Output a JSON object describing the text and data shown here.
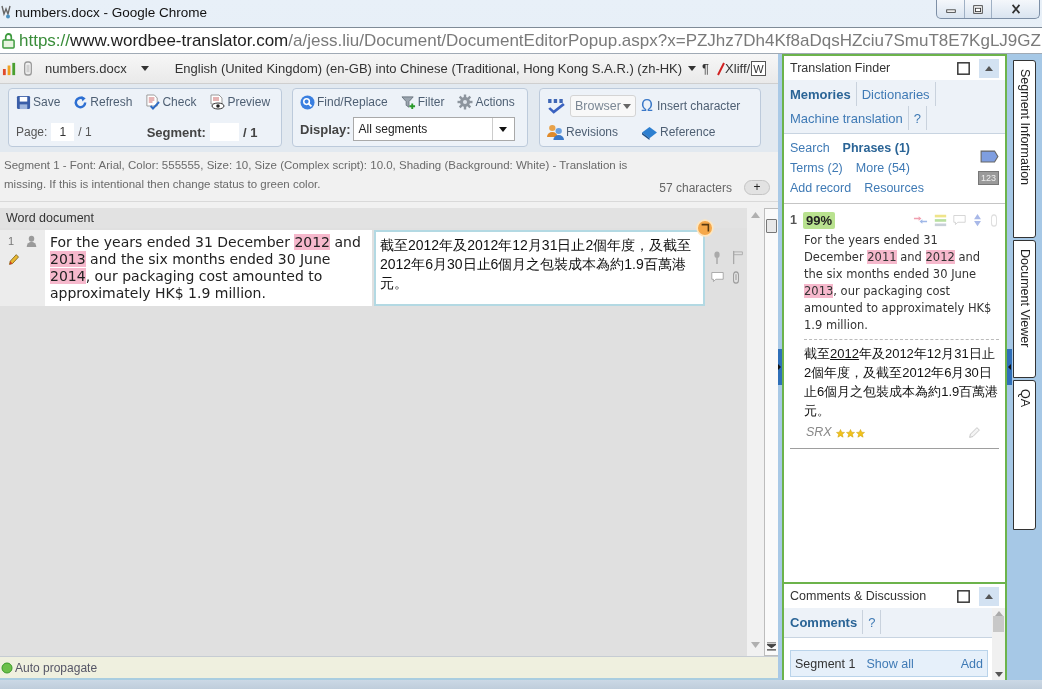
{
  "window": {
    "title": "numbers.docx - Google Chrome"
  },
  "address_bar": {
    "scheme": "https://",
    "host": "www.wordbee-translator.com",
    "path": "/a/jess.liu/Document/DocumentEditorPopup.aspx?x=PZJhz7Dh4Kf8aDqsHZciu7SmuT8E7KgLJ9GZ"
  },
  "document_bar": {
    "file": "numbers.docx",
    "languages": "English (United Kingdom) (en-GB) into Chinese (Traditional, Hong Kong S.A.R.) (zh-HK)",
    "pilcrow": "¶",
    "export": {
      "xliff": "Xliff/",
      "word": "W"
    }
  },
  "toolbar": {
    "edit_group": {
      "buttons": [
        {
          "kind": "save",
          "label": "Save"
        },
        {
          "kind": "refresh",
          "label": "Refresh"
        },
        {
          "kind": "check",
          "label": "Check"
        },
        {
          "kind": "preview",
          "label": "Preview"
        }
      ],
      "page": {
        "label": "Page:",
        "value": "1",
        "total": "/ 1"
      },
      "segment": {
        "label": "Segment:",
        "total": "/ 1"
      }
    },
    "search_group": {
      "buttons": [
        {
          "kind": "find",
          "label": "Find/Replace"
        },
        {
          "kind": "filter",
          "label": "Filter"
        },
        {
          "kind": "actions",
          "label": "Actions"
        }
      ],
      "display": {
        "label": "Display:",
        "value": "All segments"
      }
    },
    "tools_group": {
      "spellcheck": {
        "label": "Browser"
      },
      "buttons": [
        {
          "kind": "insert",
          "glyph": "Ω",
          "label": "Insert character"
        },
        {
          "kind": "revisions",
          "label": "Revisions"
        },
        {
          "kind": "reference",
          "label": "Reference"
        }
      ]
    }
  },
  "segment_info": {
    "message": "Segment 1 - Font: Arial, Color: 555555, Size: 10, Size (Complex script): 10.0, Shading (Background: White) - Translation is missing. If this is intentional then change status to green color.",
    "character_count": "57 characters",
    "expand_button": "+"
  },
  "document": {
    "header": "Word document",
    "segments": [
      {
        "number": "1",
        "source": [
          {
            "text": "For the years ended 31 December ",
            "kind": "plain"
          },
          {
            "text": "2012",
            "kind": "highlight"
          },
          {
            "text": " and ",
            "kind": "plain"
          },
          {
            "text": "2013",
            "kind": "highlight"
          },
          {
            "text": " and the six months ended 30 June ",
            "kind": "plain"
          },
          {
            "text": "2014",
            "kind": "highlight"
          },
          {
            "text": ", our packaging cost amounted to approximately HK$ 1.9 million.",
            "kind": "plain"
          }
        ],
        "target": [
          {
            "text": "截至2012年及2012年12月31日止2個年度，及截至2012年6月30日止6個月之包裝成本為約1.9百萬港元。",
            "kind": "plain"
          }
        ]
      }
    ]
  },
  "status_bar": {
    "auto_propagate": {
      "label": "Auto propagate",
      "on": true
    }
  },
  "translation_finder": {
    "title": "Translation Finder",
    "tabs": [
      {
        "label": "Memories",
        "selected": true
      },
      {
        "label": "Dictionaries",
        "selected": false
      },
      {
        "label": "Machine translation",
        "selected": false
      },
      {
        "label": "?",
        "selected": false
      }
    ],
    "link_rows": [
      [
        {
          "label": "Search",
          "selected": false
        },
        {
          "label": "Phrases (1)",
          "selected": true
        }
      ],
      [
        {
          "label": "Terms (2)",
          "selected": false
        },
        {
          "label": "More (54)",
          "selected": false
        }
      ],
      [
        {
          "label": "Add record",
          "selected": false
        },
        {
          "label": "Resources",
          "selected": false
        }
      ]
    ],
    "numbers_badge": "123",
    "matches": [
      {
        "rank": "1",
        "score": "99%",
        "source": [
          {
            "text": "For the years ended 31 December ",
            "kind": "plain"
          },
          {
            "text": "2011",
            "kind": "highlight"
          },
          {
            "text": " and ",
            "kind": "plain"
          },
          {
            "text": "2012",
            "kind": "highlight"
          },
          {
            "text": " and the six months ended 30 June ",
            "kind": "plain"
          },
          {
            "text": "2013",
            "kind": "highlight"
          },
          {
            "text": ", our packaging cost amounted to approximately HK$ 1.9 million.",
            "kind": "plain"
          }
        ],
        "target": [
          {
            "text": "截至",
            "kind": "plain"
          },
          {
            "text": "2012",
            "kind": "underline"
          },
          {
            "text": "年及2012年12月31日止2個年度，及截至2012年6月30日止6個月之包裝成本為約1.9百萬港元。",
            "kind": "plain"
          }
        ],
        "origin": "SRX",
        "stars": 3
      }
    ]
  },
  "comments": {
    "title": "Comments & Discussion",
    "tabs": [
      {
        "label": "Comments",
        "selected": true
      },
      {
        "label": "?",
        "selected": false
      }
    ],
    "entry": {
      "segment": "Segment 1",
      "show_all": "Show all",
      "add": "Add"
    }
  },
  "side_tabs": [
    {
      "label": "Segment Information",
      "selected": false
    },
    {
      "label": "Document Viewer",
      "selected": false
    },
    {
      "label": "QA",
      "selected": false
    }
  ]
}
